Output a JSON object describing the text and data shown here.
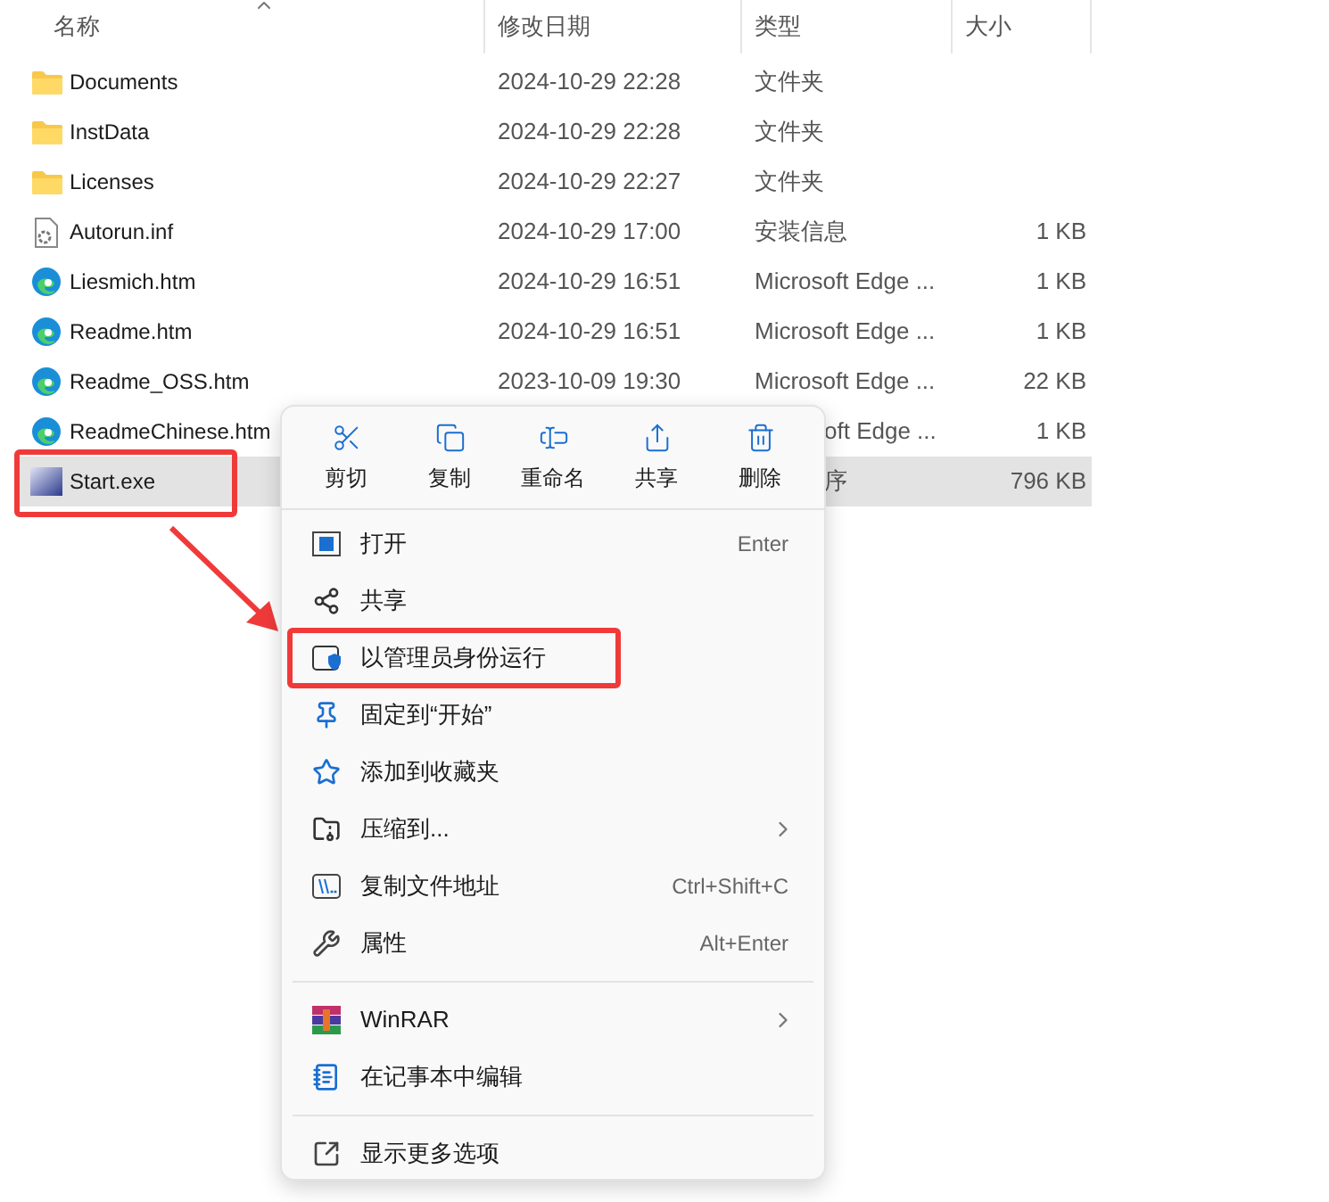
{
  "columns": [
    {
      "label": "名称",
      "sorted": true
    },
    {
      "label": "修改日期",
      "sorted": false
    },
    {
      "label": "类型",
      "sorted": false
    },
    {
      "label": "大小",
      "sorted": false
    }
  ],
  "files": [
    {
      "kind": "folder",
      "name": "Documents",
      "date": "2024-10-29 22:28",
      "type": "文件夹",
      "selected": false,
      "highlighted": false,
      "covered": false
    },
    {
      "kind": "folder",
      "name": "InstData",
      "date": "2024-10-29 22:28",
      "type": "文件夹",
      "selected": false,
      "highlighted": false,
      "covered": false
    },
    {
      "kind": "folder",
      "name": "Licenses",
      "date": "2024-10-29 22:27",
      "type": "文件夹",
      "selected": false,
      "highlighted": false,
      "covered": false
    },
    {
      "kind": "inf",
      "name": "Autorun.inf",
      "date": "2024-10-29 17:00",
      "type": "安装信息",
      "size": "1 KB",
      "selected": false,
      "highlighted": false,
      "covered": false
    },
    {
      "kind": "edge",
      "name": "Liesmich.htm",
      "date": "2024-10-29 16:51",
      "type": "Microsoft Edge ...",
      "size": "1 KB",
      "selected": false,
      "highlighted": false,
      "covered": false
    },
    {
      "kind": "edge",
      "name": "Readme.htm",
      "date": "2024-10-29 16:51",
      "type": "Microsoft Edge ...",
      "size": "1 KB",
      "selected": false,
      "highlighted": false,
      "covered": false
    },
    {
      "kind": "edge",
      "name": "Readme_OSS.htm",
      "date": "2023-10-09 19:30",
      "type": "Microsoft Edge ...",
      "size": "22 KB",
      "selected": false,
      "highlighted": false,
      "covered": false
    },
    {
      "kind": "edge",
      "name": "ReadmeChinese.htm",
      "type": "oft Edge ...",
      "size": "1 KB",
      "selected": false,
      "highlighted": false,
      "covered": true
    },
    {
      "kind": "exe",
      "name": "Start.exe",
      "type": "序",
      "size": "796 KB",
      "selected": true,
      "highlighted": true,
      "covered": true
    }
  ],
  "context_menu": {
    "toolbar": [
      {
        "label": "剪切"
      },
      {
        "label": "复制"
      },
      {
        "label": "重命名"
      },
      {
        "label": "共享"
      },
      {
        "label": "删除"
      }
    ],
    "items": [
      {
        "kind": "item",
        "label": "打开",
        "shortcut": "Enter",
        "submenu": false,
        "highlighted": false
      },
      {
        "kind": "item",
        "label": "共享",
        "submenu": false,
        "highlighted": false
      },
      {
        "kind": "item",
        "label": "以管理员身份运行",
        "submenu": false,
        "highlighted": true
      },
      {
        "kind": "item",
        "label": "固定到“开始”",
        "submenu": false,
        "highlighted": false
      },
      {
        "kind": "item",
        "label": "添加到收藏夹",
        "submenu": false,
        "highlighted": false
      },
      {
        "kind": "item",
        "label": "压缩到...",
        "submenu": true,
        "highlighted": false
      },
      {
        "kind": "item",
        "label": "复制文件地址",
        "shortcut": "Ctrl+Shift+C",
        "submenu": false,
        "highlighted": false
      },
      {
        "kind": "item",
        "label": "属性",
        "shortcut": "Alt+Enter",
        "submenu": false,
        "highlighted": false
      },
      {
        "kind": "separator"
      },
      {
        "kind": "item",
        "label": "WinRAR",
        "submenu": true,
        "highlighted": false
      },
      {
        "kind": "item",
        "label": "在记事本中编辑",
        "submenu": false,
        "highlighted": false
      },
      {
        "kind": "separator"
      },
      {
        "kind": "item",
        "label": "显示更多选项",
        "submenu": false,
        "highlighted": false
      }
    ]
  }
}
